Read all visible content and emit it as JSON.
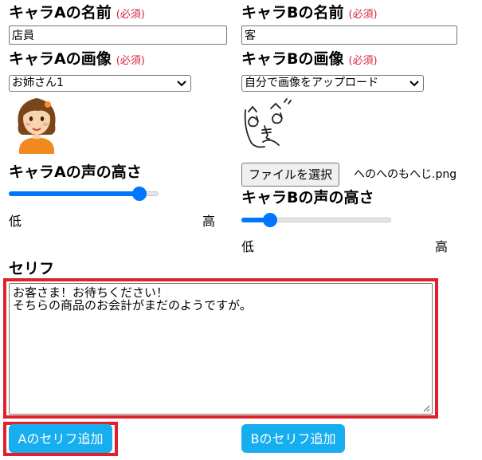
{
  "charA": {
    "name_label": "キャラAの名前",
    "required": "(必須)",
    "name_value": "店員",
    "image_label": "キャラAの画像",
    "image_select": "お姉さん1",
    "voice_label": "キャラAの声の高さ",
    "voice_level": 0.87,
    "low": "低",
    "high": "高"
  },
  "charB": {
    "name_label": "キャラBの名前",
    "required": "(必須)",
    "name_value": "客",
    "image_label": "キャラBの画像",
    "image_select": "自分で画像をアップロード",
    "file_button": "ファイルを選択",
    "file_name": "へのへのもへじ.png",
    "voice_label": "キャラBの声の高さ",
    "voice_level": 0.19,
    "low": "低",
    "high": "高"
  },
  "serif": {
    "label": "セリフ",
    "text": "お客さま！お待ちください！\nそちらの商品のお会計がまだのようですが。"
  },
  "buttons": {
    "add_a": "Aのセリフ追加",
    "add_b": "Bのセリフ追加"
  },
  "colors": {
    "accent": "#0075ff",
    "button": "#17aef0",
    "highlight": "#e0202a",
    "required": "#d7263d"
  }
}
